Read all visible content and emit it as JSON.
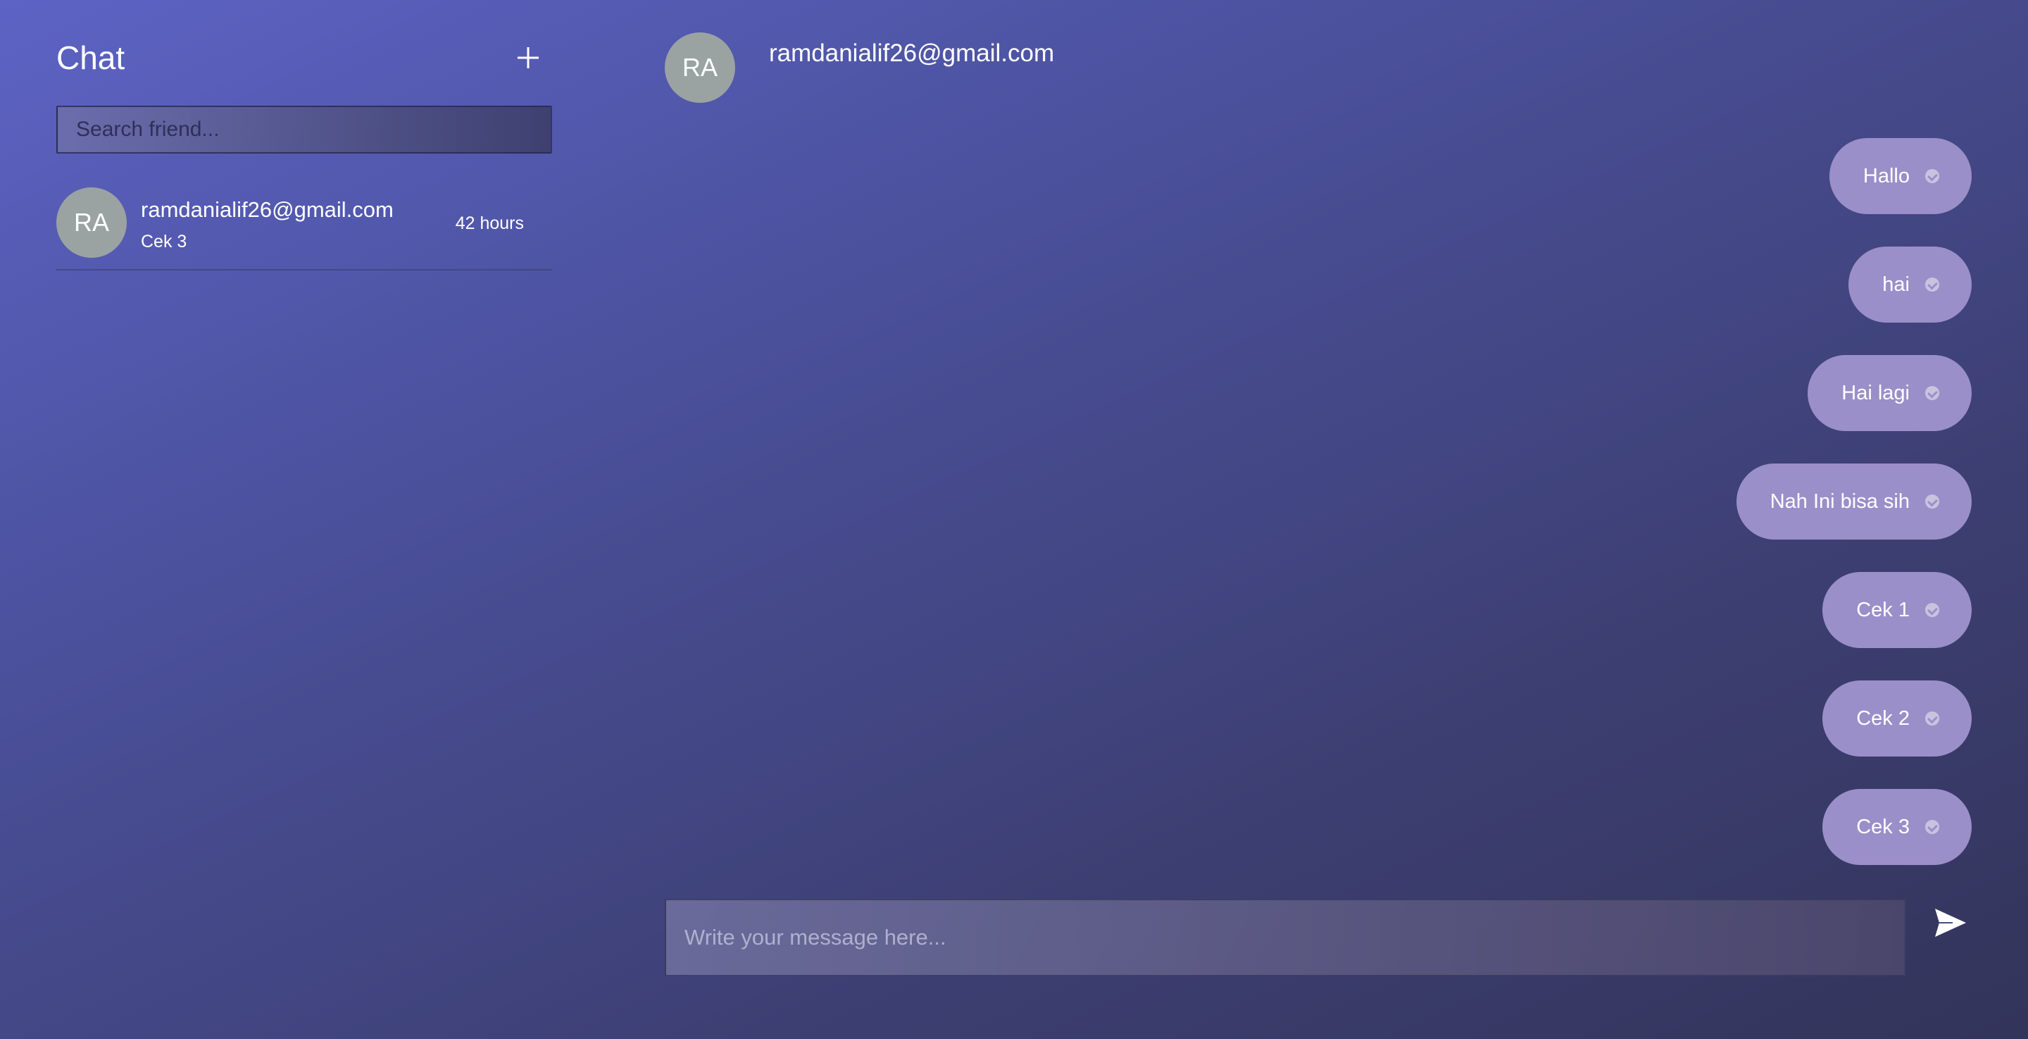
{
  "sidebar": {
    "title": "Chat",
    "new_chat_icon": "plus-icon",
    "search": {
      "placeholder": "Search friend...",
      "value": ""
    },
    "friends": [
      {
        "initials": "RA",
        "name": "ramdanialif26@gmail.com",
        "last_message": "Cek 3",
        "time": "42 hours"
      }
    ]
  },
  "chat": {
    "header": {
      "initials": "RA",
      "name": "ramdanialif26@gmail.com"
    },
    "messages": [
      {
        "text": "Hallo",
        "status_icon": "check-icon"
      },
      {
        "text": "hai",
        "status_icon": "check-icon"
      },
      {
        "text": "Hai lagi",
        "status_icon": "check-icon"
      },
      {
        "text": "Nah Ini bisa sih",
        "status_icon": "check-icon"
      },
      {
        "text": "Cek 1",
        "status_icon": "check-icon"
      },
      {
        "text": "Cek 2",
        "status_icon": "check-icon"
      },
      {
        "text": "Cek 3",
        "status_icon": "check-icon"
      }
    ],
    "composer": {
      "placeholder": "Write your message here...",
      "value": "",
      "send_icon": "send-icon"
    }
  },
  "colors": {
    "background_start": "#5d63c4",
    "background_end": "#33345a",
    "bubble": "#9b8fc9",
    "avatar": "#9aa3a2"
  }
}
